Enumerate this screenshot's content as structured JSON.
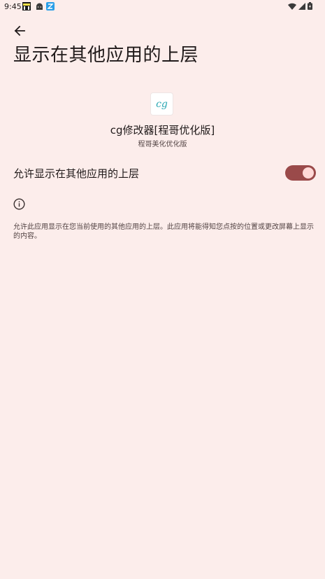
{
  "status_bar": {
    "time": "9:45",
    "notification_icons": [
      "game-app-icon",
      "android-icon",
      "file-transfer-icon"
    ],
    "system_icons": [
      "wifi-icon",
      "signal-icon",
      "battery-icon"
    ]
  },
  "header": {
    "back_icon": "arrow-back-icon",
    "title": "显示在其他应用的上层"
  },
  "app": {
    "icon_text": "cg",
    "name": "cg修改器[程哥优化版]",
    "subtitle": "程哥美化优化版"
  },
  "setting": {
    "label": "允许显示在其他应用的上层",
    "enabled": true
  },
  "info": {
    "icon": "info-icon",
    "text": "允许此应用显示在您当前使用的其他应用的上层。此应用将能得知您点按的位置或更改屏幕上显示的内容。"
  },
  "colors": {
    "background": "#fcedeb",
    "toggle_track": "#9a4a4a",
    "toggle_thumb": "#ffd9d7",
    "app_icon_text": "#2aa7b3"
  }
}
